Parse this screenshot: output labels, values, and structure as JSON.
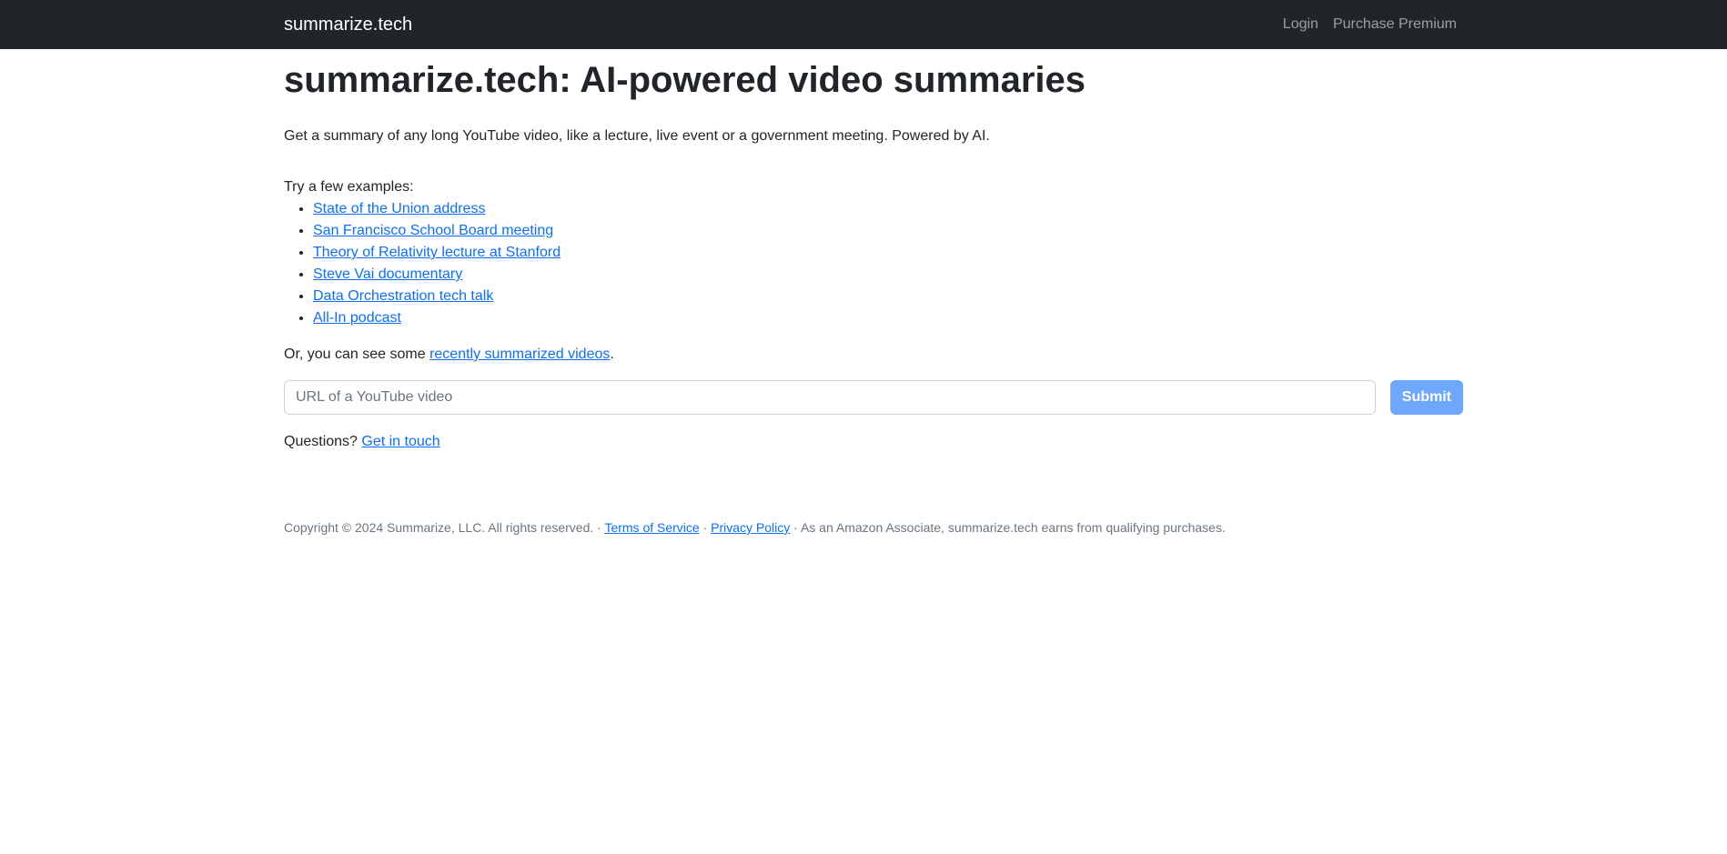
{
  "navbar": {
    "brand": "summarize.tech",
    "links": [
      "Login",
      "Purchase Premium"
    ]
  },
  "main": {
    "title": "summarize.tech: AI-powered video summaries",
    "lead": "Get a summary of any long YouTube video, like a lecture, live event or a government meeting. Powered by AI.",
    "examples_intro": "Try a few examples:",
    "examples": [
      "State of the Union address",
      "San Francisco School Board meeting",
      "Theory of Relativity lecture at Stanford",
      "Steve Vai documentary",
      "Data Orchestration tech talk",
      "All-In podcast"
    ],
    "recent_prefix": "Or, you can see some ",
    "recent_link": "recently summarized videos",
    "recent_suffix": ".",
    "url_placeholder": "URL of a YouTube video",
    "submit_label": "Submit",
    "questions_prefix": "Questions? ",
    "questions_link": "Get in touch"
  },
  "footer": {
    "copyright": "Copyright © 2024 Summarize, LLC. All rights reserved. · ",
    "terms": "Terms of Service",
    "sep": " · ",
    "privacy": "Privacy Policy",
    "amazon": " · As an Amazon Associate, summarize.tech earns from qualifying purchases."
  },
  "colors": {
    "navbar_bg": "#212529",
    "link": "#0d6efd",
    "submit_bg": "#6ea8fe"
  }
}
